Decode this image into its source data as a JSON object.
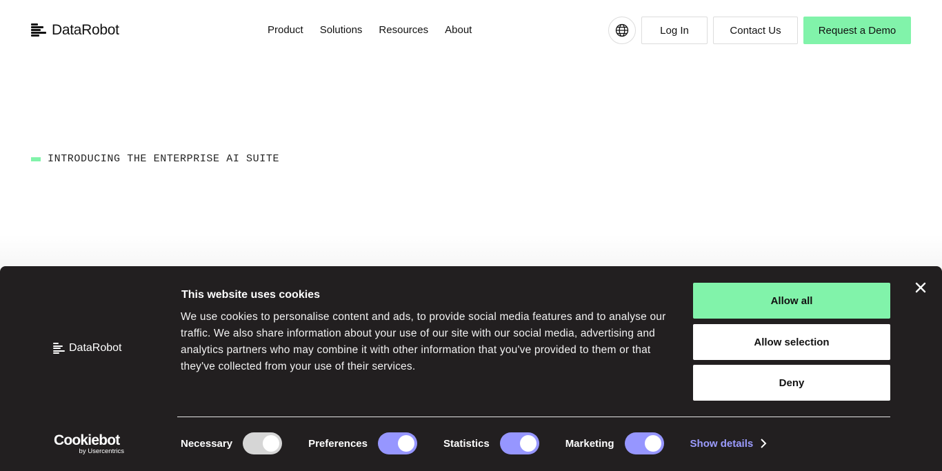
{
  "header": {
    "logo_text": "DataRobot",
    "nav": [
      "Product",
      "Solutions",
      "Resources",
      "About"
    ],
    "globe_icon": "globe-icon",
    "login_label": "Log In",
    "contact_label": "Contact Us",
    "demo_label": "Request a Demo"
  },
  "hero": {
    "eyebrow": "INTRODUCING THE ENTERPRISE AI SUITE"
  },
  "cookie": {
    "logo_text": "DataRobot",
    "title": "This website uses cookies",
    "body": "We use cookies to personalise content and ads, to provide social media features and to analyse our traffic. We also share information about your use of our site with our social media, advertising and analytics partners who may combine it with other information that you've provided to them or that they've collected from your use of their services.",
    "allow_all": "Allow all",
    "allow_selection": "Allow selection",
    "deny": "Deny",
    "close_icon": "close-icon",
    "toggles": {
      "necessary": "Necessary",
      "preferences": "Preferences",
      "statistics": "Statistics",
      "marketing": "Marketing"
    },
    "show_details": "Show details",
    "brand_main": "Cookiebot",
    "brand_sub": "by Usercentrics"
  },
  "colors": {
    "accent_green": "#81f3aa",
    "banner_bg": "#221f20",
    "toggle_on": "#9696ff",
    "link": "#9c9cff"
  }
}
